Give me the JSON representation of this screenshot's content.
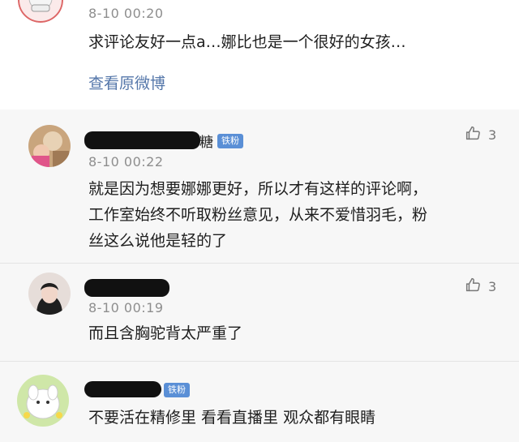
{
  "original_post": {
    "timestamp": "8-10 00:20",
    "text": "求评论友好一点a…娜比也是一个很好的女孩…",
    "view_original": "查看原微博"
  },
  "comments": [
    {
      "name_visible_suffix": "糖",
      "badge": "铁粉",
      "timestamp": "8-10 00:22",
      "likes": "3",
      "lines": [
        "就是因为想要娜娜更好，所以才有这样的评论啊，",
        "工作室始终不听取粉丝意见，从来不爱惜羽毛，粉",
        "丝这么说他是轻的了"
      ]
    },
    {
      "timestamp": "8-10 00:19",
      "likes": "3",
      "lines": [
        "而且含胸驼背太严重了"
      ]
    },
    {
      "badge": "铁粉",
      "lines": [
        "不要活在精修里 看看直播里 观众都有眼睛"
      ]
    }
  ],
  "icons": {
    "like": "thumbs-up-icon"
  },
  "colors": {
    "badge": "#5a8fd6",
    "link": "#5577aa",
    "timestamp": "#8e8e8e"
  }
}
